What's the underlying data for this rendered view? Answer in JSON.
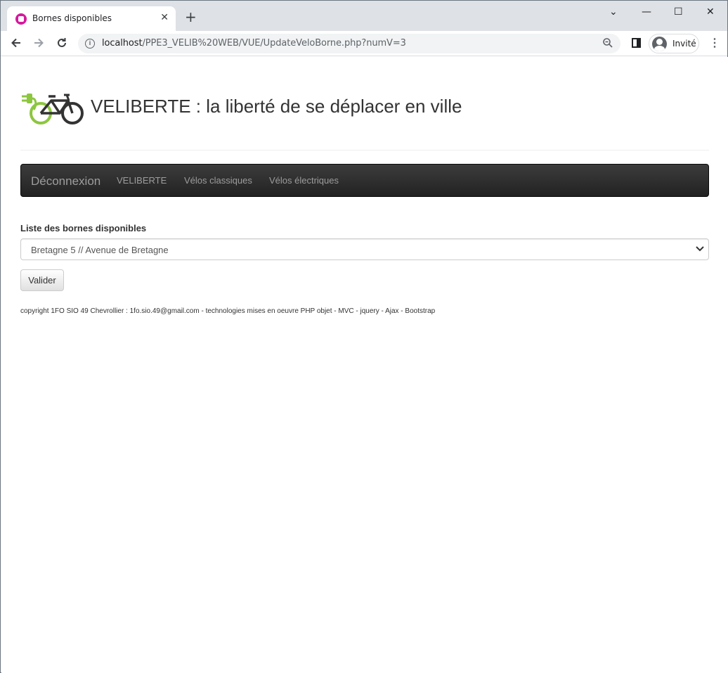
{
  "browser": {
    "tab_title": "Bornes disponibles",
    "tab_close": "✕",
    "new_tab": "+",
    "window_controls": {
      "minimize": "—",
      "maximize": "☐",
      "close": "✕",
      "dropdown": "⌄"
    },
    "url_host": "localhost",
    "url_path": "/PPE3_VELIB%20WEB/VUE/UpdateVeloBorne.php?numV=3",
    "profile_label": "Invité",
    "icons": [
      "back-icon",
      "forward-icon",
      "reload-icon",
      "info-icon",
      "zoom-icon",
      "side-panel-icon",
      "avatar",
      "menu-icon"
    ]
  },
  "header": {
    "title": "VELIBERTE : la liberté de se déplacer en ville"
  },
  "navbar": {
    "brand": "Déconnexion",
    "links": [
      "VELIBERTE",
      "Vélos classiques",
      "Vélos électriques"
    ]
  },
  "form": {
    "label": "Liste des bornes disponibles",
    "selected": "Bretagne 5 // Avenue de Bretagne",
    "submit": "Valider"
  },
  "footer": {
    "text": "copyright 1FO SIO 49 Chevrollier : 1fo.sio.49@gmail.com - technologies mises en oeuvre PHP objet - MVC - jquery - Ajax - Bootstrap"
  },
  "colors": {
    "logo_green": "#8dc63f",
    "logo_dark": "#333333",
    "navbar_bg": "#222222",
    "nav_text": "#9d9d9d"
  }
}
